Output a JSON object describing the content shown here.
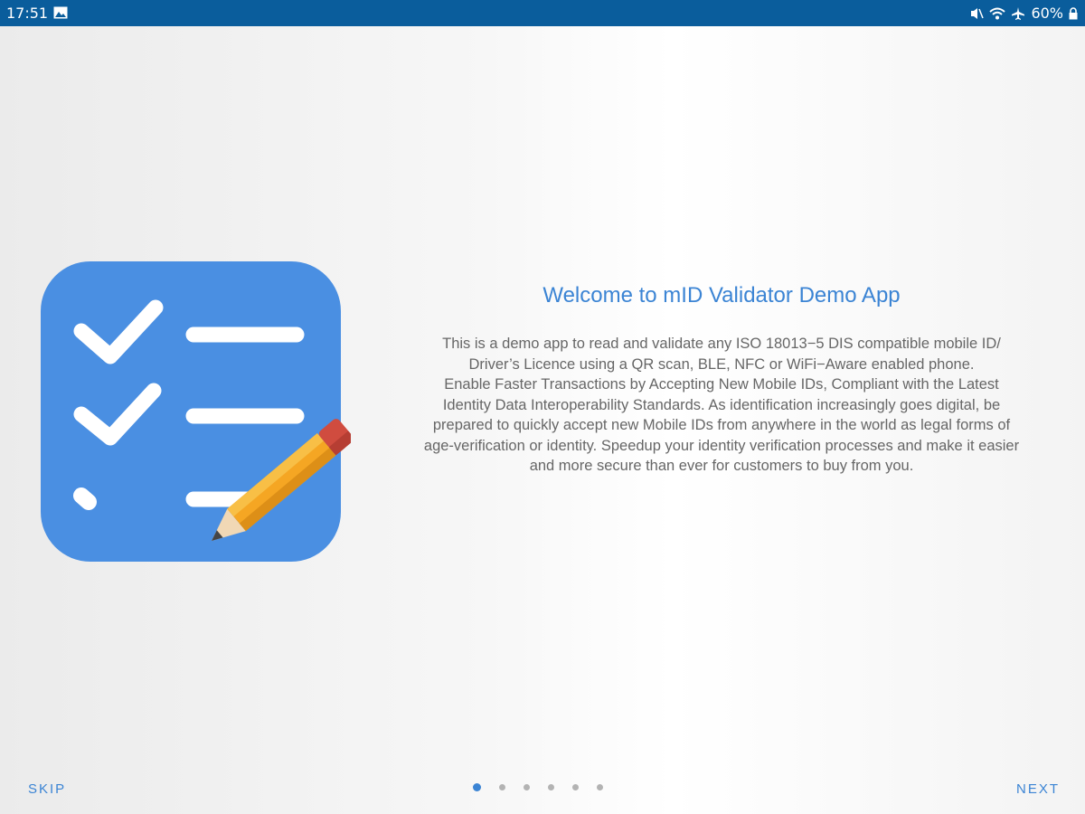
{
  "status_bar": {
    "time": "17:51",
    "battery": "60%",
    "icons": [
      "gallery-icon",
      "mute-icon",
      "wifi-icon",
      "airplane-icon",
      "lock-icon"
    ]
  },
  "illustration": {
    "icon": "checklist-pencil-icon",
    "background_color": "#4a8fe2"
  },
  "intro": {
    "title": "Welcome to mID Validator Demo App",
    "paragraph_lines": [
      "This is a demo app to read and validate any ISO 18013−5 DIS compatible mobile ID/",
      "Driver’s Licence using a QR scan, BLE, NFC or WiFi−Aware enabled phone.",
      "Enable Faster Transactions by Accepting New Mobile IDs, Compliant with the Latest",
      "Identity Data Interoperability Standards. As identification increasingly goes digital, be",
      "prepared to quickly accept new Mobile IDs from anywhere in the world as legal forms of",
      "age-verification or identity. Speedup your identity verification processes and make it easier",
      "and more secure than ever for customers to buy from you."
    ]
  },
  "navigation": {
    "skip_label": "SKIP",
    "next_label": "NEXT",
    "page_count": 6,
    "current_page": 1
  },
  "colors": {
    "accent": "#3b84d4",
    "status_bar": "#0a5d9c",
    "inactive_dot": "#b3b3b3"
  }
}
